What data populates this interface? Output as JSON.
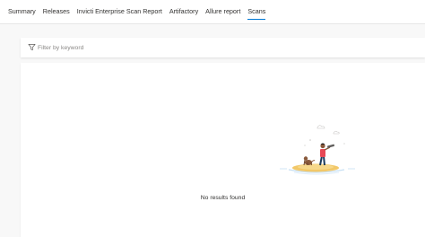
{
  "tabs": [
    {
      "label": "Summary",
      "active": false
    },
    {
      "label": "Releases",
      "active": false
    },
    {
      "label": "Invicti Enterprise Scan Report",
      "active": false
    },
    {
      "label": "Artifactory",
      "active": false
    },
    {
      "label": "Allure report",
      "active": false
    },
    {
      "label": "Scans",
      "active": true
    }
  ],
  "filter": {
    "placeholder": "Filter by keyword",
    "value": "",
    "icon": "filter-icon"
  },
  "empty_state": {
    "message": "No results found",
    "illustration": "island-illustration"
  },
  "colors": {
    "accent": "#0078d4",
    "page_background": "#f8f8f8",
    "panel_background": "#ffffff"
  }
}
